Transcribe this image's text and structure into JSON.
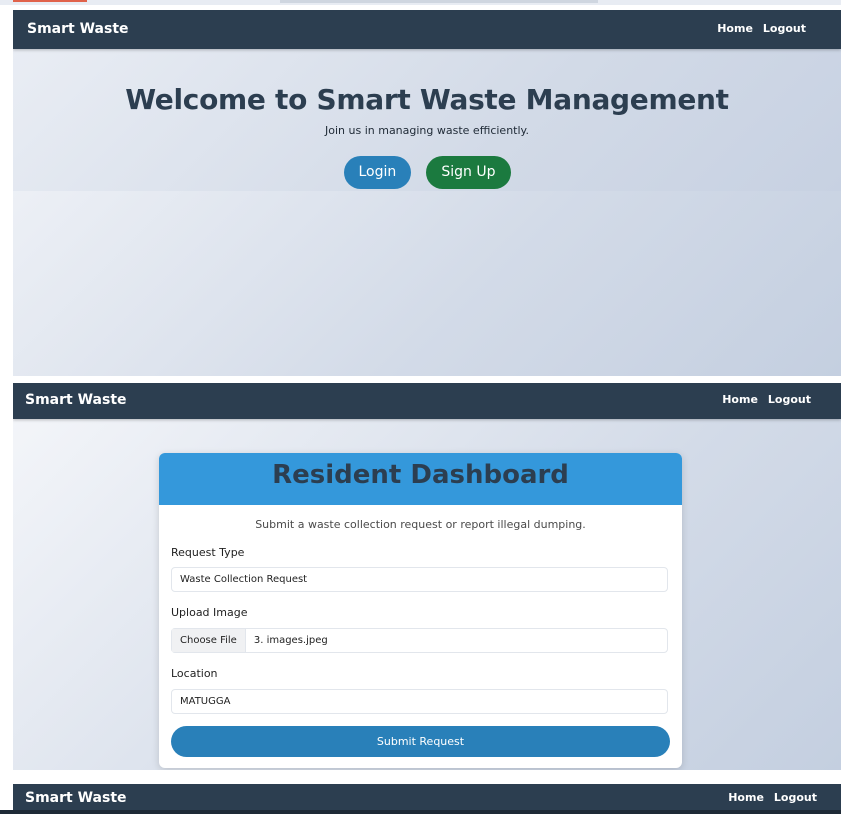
{
  "nav": {
    "brand": "Smart Waste",
    "home": "Home",
    "logout": "Logout"
  },
  "landing": {
    "title": "Welcome to Smart Waste Management",
    "subtitle": "Join us in managing waste efficiently.",
    "login_label": "Login",
    "signup_label": "Sign Up"
  },
  "dashboard": {
    "title": "Resident Dashboard",
    "subtitle": "Submit a waste collection request or report illegal dumping.",
    "request_type_label": "Request Type",
    "request_type_value": "Waste Collection Request",
    "upload_label": "Upload Image",
    "choose_file_label": "Choose File",
    "file_name": "3. images.jpeg",
    "location_label": "Location",
    "location_value": "MATUGGA",
    "submit_label": "Submit Request"
  },
  "colors": {
    "navbar": "#2c3e50",
    "primary": "#2980b9",
    "success": "#1b7a3f",
    "card_header": "#3498db"
  }
}
